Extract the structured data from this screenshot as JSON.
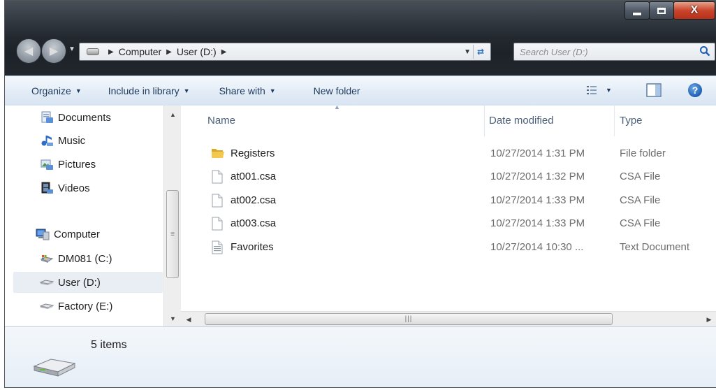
{
  "window": {
    "controls": {
      "minimize": "",
      "maximize": "",
      "close": "X"
    }
  },
  "address_bar": {
    "crumbs": [
      "Computer",
      "User (D:)"
    ],
    "icon": "drive-icon"
  },
  "search": {
    "placeholder": "Search User (D:)"
  },
  "toolbar": {
    "organize": "Organize",
    "include_in_library": "Include in library",
    "share_with": "Share with",
    "new_folder": "New folder",
    "help": "?"
  },
  "nav": {
    "items": [
      {
        "label": "Documents",
        "icon": "documents-icon"
      },
      {
        "label": "Music",
        "icon": "music-icon"
      },
      {
        "label": "Pictures",
        "icon": "pictures-icon"
      },
      {
        "label": "Videos",
        "icon": "videos-icon"
      },
      {
        "label": "Computer",
        "icon": "computer-icon"
      },
      {
        "label": "DM081 (C:)",
        "icon": "system-drive-icon"
      },
      {
        "label": "User (D:)",
        "icon": "drive-icon",
        "selected": true
      },
      {
        "label": "Factory (E:)",
        "icon": "drive-icon"
      }
    ]
  },
  "columns": {
    "name": "Name",
    "date": "Date modified",
    "type": "Type"
  },
  "files": [
    {
      "name": "Registers",
      "date": "10/27/2014 1:31 PM",
      "type": "File folder",
      "icon": "folder-icon"
    },
    {
      "name": "at001.csa",
      "date": "10/27/2014 1:32 PM",
      "type": "CSA File",
      "icon": "file-icon"
    },
    {
      "name": "at002.csa",
      "date": "10/27/2014 1:33 PM",
      "type": "CSA File",
      "icon": "file-icon"
    },
    {
      "name": "at003.csa",
      "date": "10/27/2014 1:33 PM",
      "type": "CSA File",
      "icon": "file-icon"
    },
    {
      "name": "Favorites",
      "date": "10/27/2014 10:30 ...",
      "type": "Text Document",
      "icon": "text-file-icon"
    }
  ],
  "details": {
    "count": "5 items"
  },
  "colors": {
    "titlebar": "#22272e",
    "toolbar_text": "#1e395b",
    "header_text": "#4c607a",
    "secondary_text": "#6d6d6d",
    "selection": "#e9eef4"
  }
}
